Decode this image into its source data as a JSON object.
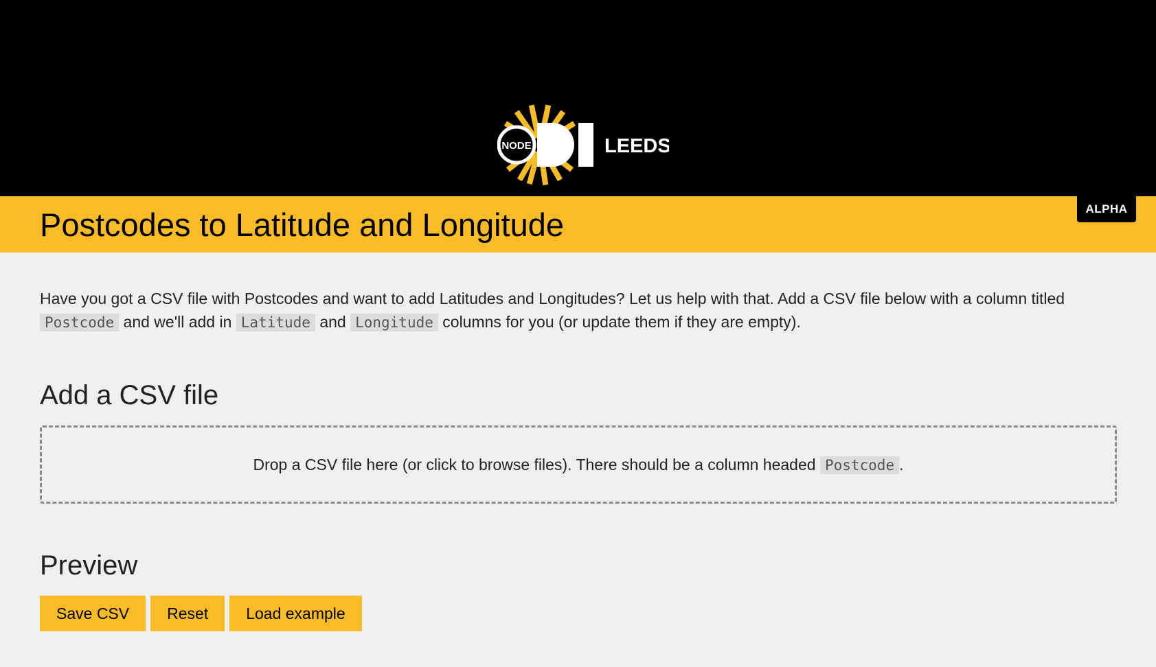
{
  "header": {
    "logo": {
      "badge_text": "NODE",
      "city": "LEEDS",
      "accent_color": "#f9bc26"
    },
    "alpha_badge": "ALPHA"
  },
  "page": {
    "title": "Postcodes to Latitude and Longitude",
    "intro": {
      "part1": "Have you got a CSV file with Postcodes and want to add Latitudes and Longitudes? Let us help with that. Add a CSV file below with a column titled ",
      "code1": "Postcode",
      "part2": " and we'll add in ",
      "code2": "Latitude",
      "part3": " and ",
      "code3": "Longitude",
      "part4": " columns for you (or update them if they are empty)."
    }
  },
  "upload": {
    "heading": "Add a CSV file",
    "drop_text": "Drop a CSV file here (or click to browse files). There should be a column headed ",
    "drop_code": "Postcode",
    "drop_end": "."
  },
  "preview": {
    "heading": "Preview",
    "buttons": {
      "save": "Save CSV",
      "reset": "Reset",
      "load_example": "Load example"
    }
  },
  "colors": {
    "brand_yellow": "#f9bc26",
    "header_bg": "#000000",
    "page_bg": "#efefef"
  }
}
